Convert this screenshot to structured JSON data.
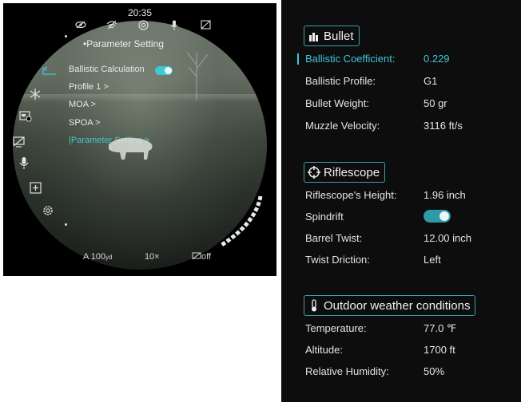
{
  "scope": {
    "time": "20:35",
    "menu_title": "•Parameter Setting",
    "menu_items": [
      {
        "label": "Ballistic Calculation",
        "active": false
      },
      {
        "label": "Profile 1 >",
        "active": false
      },
      {
        "label": "MOA >",
        "active": false
      },
      {
        "label": "SPOA >",
        "active": false
      },
      {
        "label": "|Parameter Setting >",
        "active": true
      }
    ],
    "ballistic_calculation_on": true,
    "status_icons": [
      "eye-off-icon",
      "wifi-off-icon",
      "settings-target-icon",
      "mic-icon",
      "image-off-icon"
    ],
    "side_icons": [
      "snowflake-icon",
      "display-mode-icon",
      "monitor-off-icon",
      "microphone-icon",
      "add-square-icon",
      "gear-icon"
    ],
    "bottom": {
      "distance_prefix": "A 100",
      "distance_unit": "yd",
      "zoom": "10×",
      "pip_status": "off"
    },
    "accent_color": "#41c6d6"
  },
  "settings": {
    "bullet": {
      "header": "Bullet",
      "icon": "bullet-icon",
      "rows": [
        {
          "label": "Ballistic Coefficient:",
          "value": "0.229",
          "active": true
        },
        {
          "label": "Ballistic Profile:",
          "value": "G1"
        },
        {
          "label": "Bullet Weight:",
          "value": "50 gr"
        },
        {
          "label": "Muzzle Velocity:",
          "value": "3116 ft/s"
        }
      ]
    },
    "riflescope": {
      "header": "Riflescope",
      "icon": "crosshair-icon",
      "rows": [
        {
          "label": "Riflescope's Height:",
          "value": "1.96 inch"
        },
        {
          "label": "Spindrift",
          "value": ""
        },
        {
          "label": "Barrel Twist:",
          "value": "12.00 inch"
        },
        {
          "label": "Twist Driction:",
          "value": "Left"
        }
      ],
      "spindrift_on": true
    },
    "weather": {
      "header": "Outdoor weather conditions",
      "icon": "thermometer-icon",
      "rows": [
        {
          "label": "Temperature:",
          "value": "77.0 ℉"
        },
        {
          "label": "Altitude:",
          "value": "1700 ft"
        },
        {
          "label": "Relative Humidity:",
          "value": "50%"
        }
      ]
    }
  }
}
